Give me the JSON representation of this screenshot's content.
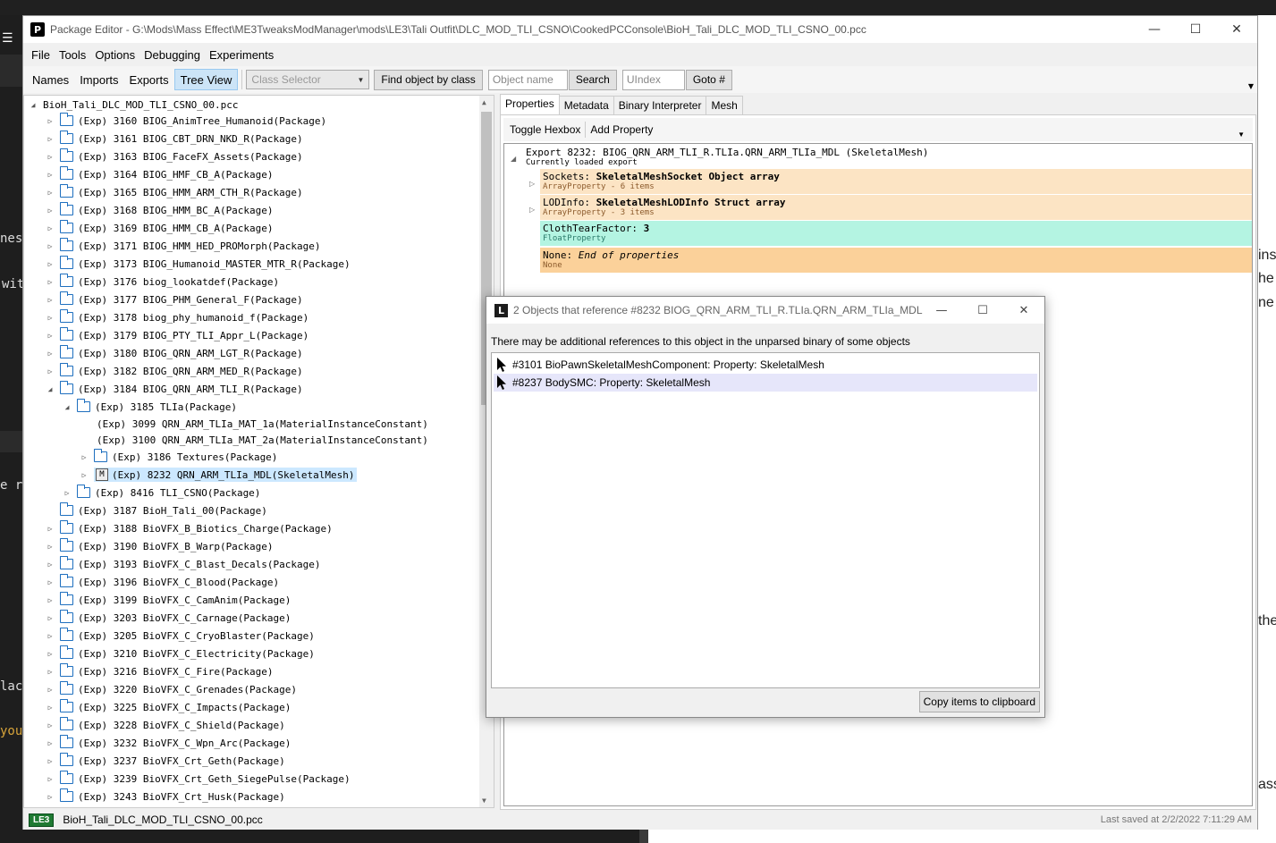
{
  "background": {
    "left_fragments": [
      "nes",
      "wit",
      "e re",
      "lac",
      "you"
    ],
    "right_fragments": [
      "ins",
      "he",
      "ne",
      "the",
      "ass"
    ]
  },
  "window": {
    "title": "Package Editor - G:\\Mods\\Mass Effect\\ME3TweaksModManager\\mods\\LE3\\Tali Outfit\\DLC_MOD_TLI_CSNO\\CookedPCConsole\\BioH_Tali_DLC_MOD_TLI_CSNO_00.pcc",
    "controls": {
      "minimize": "—",
      "maximize": "☐",
      "close": "✕"
    }
  },
  "menu": [
    "File",
    "Tools",
    "Options",
    "Debugging",
    "Experiments"
  ],
  "toolbar": {
    "views": [
      "Names",
      "Imports",
      "Exports",
      "Tree View"
    ],
    "active_view": "Tree View",
    "class_selector_placeholder": "Class Selector",
    "find_by_class": "Find object by class",
    "object_name_placeholder": "Object name",
    "search": "Search",
    "uindex_placeholder": "UIndex",
    "goto": "Goto #"
  },
  "tree": {
    "root": "BioH_Tali_DLC_MOD_TLI_CSNO_00.pcc",
    "items": [
      {
        "label": "(Exp) 3160 BIOG_AnimTree_Humanoid(Package)",
        "exp": "▷"
      },
      {
        "label": "(Exp) 3161 BIOG_CBT_DRN_NKD_R(Package)",
        "exp": "▷"
      },
      {
        "label": "(Exp) 3163 BIOG_FaceFX_Assets(Package)",
        "exp": "▷"
      },
      {
        "label": "(Exp) 3164 BIOG_HMF_CB_A(Package)",
        "exp": "▷"
      },
      {
        "label": "(Exp) 3165 BIOG_HMM_ARM_CTH_R(Package)",
        "exp": "▷"
      },
      {
        "label": "(Exp) 3168 BIOG_HMM_BC_A(Package)",
        "exp": "▷"
      },
      {
        "label": "(Exp) 3169 BIOG_HMM_CB_A(Package)",
        "exp": "▷"
      },
      {
        "label": "(Exp) 3171 BIOG_HMM_HED_PROMorph(Package)",
        "exp": "▷"
      },
      {
        "label": "(Exp) 3173 BIOG_Humanoid_MASTER_MTR_R(Package)",
        "exp": "▷"
      },
      {
        "label": "(Exp) 3176 biog_lookatdef(Package)",
        "exp": "▷"
      },
      {
        "label": "(Exp) 3177 BIOG_PHM_General_F(Package)",
        "exp": "▷"
      },
      {
        "label": "(Exp) 3178 biog_phy_humanoid_f(Package)",
        "exp": "▷"
      },
      {
        "label": "(Exp) 3179 BIOG_PTY_TLI_Appr_L(Package)",
        "exp": "▷"
      },
      {
        "label": "(Exp) 3180 BIOG_QRN_ARM_LGT_R(Package)",
        "exp": "▷"
      },
      {
        "label": "(Exp) 3182 BIOG_QRN_ARM_MED_R(Package)",
        "exp": "▷"
      },
      {
        "label": "(Exp) 3184 BIOG_QRN_ARM_TLI_R(Package)",
        "exp": "◢"
      }
    ],
    "child_tlia": "(Exp) 3185 TLIa(Package)",
    "mat1": "(Exp) 3099 QRN_ARM_TLIa_MAT_1a(MaterialInstanceConstant)",
    "mat2": "(Exp) 3100 QRN_ARM_TLIa_MAT_2a(MaterialInstanceConstant)",
    "textures": "(Exp) 3186 Textures(Package)",
    "selected_mesh": "(Exp) 8232 QRN_ARM_TLIa_MDL(SkeletalMesh)",
    "mesh_icon_letter": "M",
    "csno": "(Exp) 8416 TLI_CSNO(Package)",
    "items_after": [
      {
        "label": "(Exp) 3187 BioH_Tali_00(Package)",
        "exp": ""
      },
      {
        "label": "(Exp) 3188 BioVFX_B_Biotics_Charge(Package)",
        "exp": "▷"
      },
      {
        "label": "(Exp) 3190 BioVFX_B_Warp(Package)",
        "exp": "▷"
      },
      {
        "label": "(Exp) 3193 BioVFX_C_Blast_Decals(Package)",
        "exp": "▷"
      },
      {
        "label": "(Exp) 3196 BioVFX_C_Blood(Package)",
        "exp": "▷"
      },
      {
        "label": "(Exp) 3199 BioVFX_C_CamAnim(Package)",
        "exp": "▷"
      },
      {
        "label": "(Exp) 3203 BioVFX_C_Carnage(Package)",
        "exp": "▷"
      },
      {
        "label": "(Exp) 3205 BioVFX_C_CryoBlaster(Package)",
        "exp": "▷"
      },
      {
        "label": "(Exp) 3210 BioVFX_C_Electricity(Package)",
        "exp": "▷"
      },
      {
        "label": "(Exp) 3216 BioVFX_C_Fire(Package)",
        "exp": "▷"
      },
      {
        "label": "(Exp) 3220 BioVFX_C_Grenades(Package)",
        "exp": "▷"
      },
      {
        "label": "(Exp) 3225 BioVFX_C_Impacts(Package)",
        "exp": "▷"
      },
      {
        "label": "(Exp) 3228 BioVFX_C_Shield(Package)",
        "exp": "▷"
      },
      {
        "label": "(Exp) 3232 BioVFX_C_Wpn_Arc(Package)",
        "exp": "▷"
      },
      {
        "label": "(Exp) 3237 BioVFX_Crt_Geth(Package)",
        "exp": "▷"
      },
      {
        "label": "(Exp) 3239 BioVFX_Crt_Geth_SiegePulse(Package)",
        "exp": "▷"
      },
      {
        "label": "(Exp) 3243 BioVFX_Crt_Husk(Package)",
        "exp": "▷"
      }
    ]
  },
  "right_panel": {
    "tabs": [
      "Properties",
      "Metadata",
      "Binary Interpreter",
      "Mesh"
    ],
    "active_tab": "Properties",
    "toggle_hexbox": "Toggle Hexbox",
    "add_property": "Add Property",
    "export_header": "Export 8232: BIOG_QRN_ARM_TLI_R.TLIa.QRN_ARM_TLIa_MDL (SkeletalMesh)",
    "export_sub": "Currently loaded export",
    "props": [
      {
        "name": "Sockets: ",
        "value": "SkeletalMeshSocket Object array",
        "type": "ArrayProperty - 6 items"
      },
      {
        "name": "LODInfo: ",
        "value": "SkeletalMeshLODInfo Struct array",
        "type": "ArrayProperty - 3 items"
      },
      {
        "name": "ClothTearFactor: ",
        "value": "3",
        "type": "FloatProperty"
      },
      {
        "name": "None: ",
        "value": "End of properties",
        "type": "None"
      }
    ]
  },
  "dialog": {
    "title": "2 Objects that reference #8232 BIOG_QRN_ARM_TLI_R.TLIa.QRN_ARM_TLIa_MDL",
    "icon_letter": "L",
    "note": "There may be additional references to this object in the unparsed binary of some objects",
    "refs": [
      "#3101 BioPawnSkeletalMeshComponent: Property: SkeletalMesh",
      "#8237 BodySMC: Property: SkeletalMesh"
    ],
    "copy_button": "Copy items to clipboard"
  },
  "status": {
    "game": "LE3",
    "file": "BioH_Tali_DLC_MOD_TLI_CSNO_00.pcc",
    "saved": "Last saved at 2/2/2022 7:11:29 AM"
  },
  "colors": {
    "selection": "#cce8ff",
    "array_prop_bg": "#fce4c4",
    "float_prop_bg": "#b4f4e2",
    "none_prop_bg": "#fbd19a",
    "folder_icon": "#1e6fbf",
    "le3_badge": "#1f7a33"
  }
}
